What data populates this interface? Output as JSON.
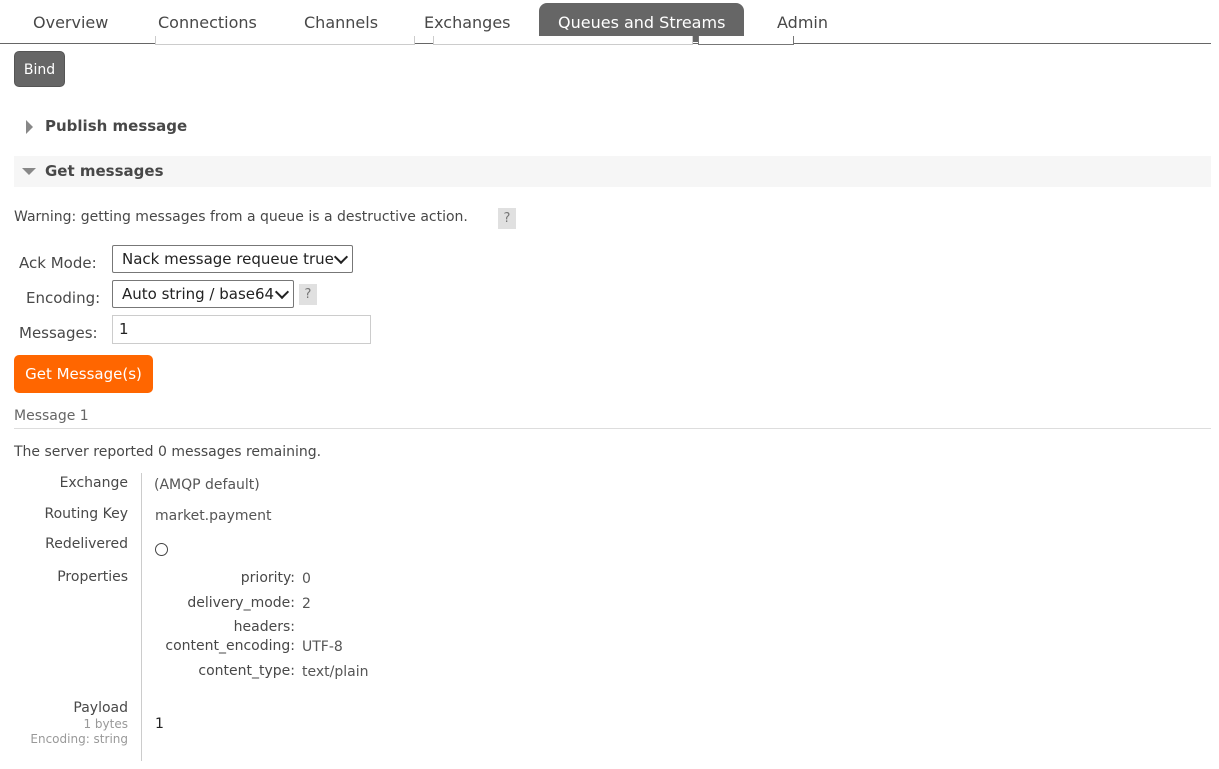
{
  "nav": {
    "tabs": [
      {
        "label": "Overview",
        "active": false
      },
      {
        "label": "Connections",
        "active": false
      },
      {
        "label": "Channels",
        "active": false
      },
      {
        "label": "Exchanges",
        "active": false
      },
      {
        "label": "Queues and Streams",
        "active": true
      },
      {
        "label": "Admin",
        "active": false
      }
    ]
  },
  "bindings": {
    "bind_label": "Bind"
  },
  "publish": {
    "title": "Publish message"
  },
  "get": {
    "title": "Get messages",
    "warning": "Warning: getting messages from a queue is a destructive action.",
    "help": "?",
    "ack_mode_label": "Ack Mode:",
    "ack_mode_value": "Nack message requeue true",
    "encoding_label": "Encoding:",
    "encoding_value": "Auto string / base64",
    "messages_label": "Messages:",
    "messages_value": "1",
    "button": "Get Message(s)"
  },
  "message": {
    "heading": "Message 1",
    "remaining": "The server reported 0 messages remaining.",
    "exchange_label": "Exchange",
    "exchange_value": "(AMQP default)",
    "routing_key_label": "Routing Key",
    "routing_key_value": "market.payment",
    "redelivered_label": "Redelivered",
    "redelivered_value": false,
    "properties_label": "Properties",
    "properties": [
      {
        "key": "priority:",
        "value": "0"
      },
      {
        "key": "delivery_mode:",
        "value": "2"
      },
      {
        "key": "headers:",
        "value": ""
      },
      {
        "key": "content_encoding:",
        "value": "UTF-8"
      },
      {
        "key": "content_type:",
        "value": "text/plain"
      }
    ],
    "payload_label": "Payload",
    "payload_size": "1 bytes",
    "payload_encoding": "Encoding: string",
    "payload_value": "1"
  },
  "colors": {
    "active_tab": "#666666",
    "primary_button": "#ff6600",
    "section_bg": "#f6f6f6"
  }
}
